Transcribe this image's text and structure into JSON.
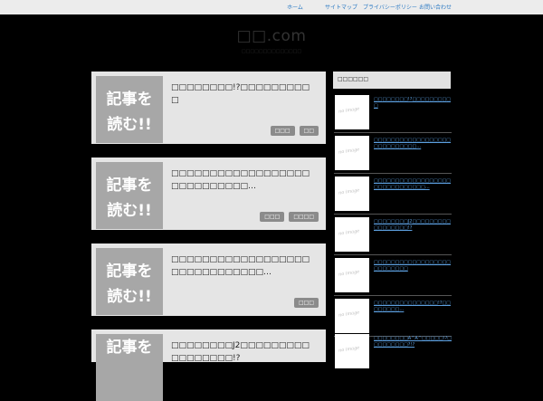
{
  "nav": [
    "ホーム",
    "サイトマップ",
    "プライバシーポリシー",
    "お問い合わせ"
  ],
  "site": {
    "logo": "□□.com",
    "tagline": "□□□□□□□□□□□□□□"
  },
  "read_more": [
    "記事を",
    "読む!!"
  ],
  "posts": [
    {
      "title": "□□□□□□□□!?□□□□□□□□□□",
      "tags": [
        "□□□",
        "□□"
      ]
    },
    {
      "title": "□□□□□□□□□□□□□□□□□□□□□□□□□□□□…",
      "tags": [
        "□□□",
        "□□□□"
      ]
    },
    {
      "title": "□□□□□□□□□□□□□□□□□□□□□□□□□□□□□□…",
      "tags": [
        "□□□"
      ]
    },
    {
      "title": "□□□□□□□□J2□□□□□□□□□□□□□□□□□!?",
      "tags": []
    }
  ],
  "sidebar": {
    "heading": "□□□□□□",
    "no_image": "no image",
    "items": [
      "□□□□□□□□!?□□□□□□□□□□",
      "□□□□□□□□□□□□□□□□□□□□□□□□□□□□…",
      "□□□□□□□□□□□□□□□□□□□□□□□□□□□□□□…",
      "□□□□□□□□J2□□□□□□□□□□□□□□□□□!?",
      "□□□□□□□□□□□□□□□□□□□□□□□□□□",
      "□□□□□□□□□□□□□□□!?□□□□□□□□…",
      "□□□□□□□□A^A^□□□□□!?□□□□□□□□□?!?"
    ]
  }
}
